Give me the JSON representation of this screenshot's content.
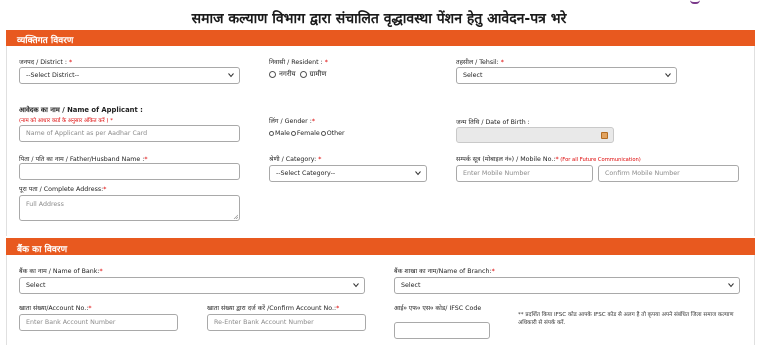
{
  "page": {
    "title": "समाज कल्याण विभाग द्वारा संचालित वृद्धावस्था पेंशन हेतु आवेदन-पत्र भरे"
  },
  "personal": {
    "heading": "व्यक्तिगत विवरण",
    "district": {
      "label": "जनपद / District :",
      "req": " *",
      "value": "--Select District--"
    },
    "resident": {
      "label": "निवासी / Resident :",
      "req": " *",
      "options": [
        "नगरीय",
        "ग्रामीण"
      ]
    },
    "tehsil": {
      "label": "तहसील / Tehsil:",
      "req": " *",
      "value": "Select"
    },
    "applicant": {
      "label": "आवेदक का नाम / Name of Applicant :",
      "hint": "(नाम को आधार कार्ड के अनुसार अंकित करें )",
      "req": " *",
      "placeholder": "Name of Applicant as per Aadhar Card"
    },
    "gender": {
      "label": "लिंग / Gender :",
      "req": "*",
      "options": [
        "Male",
        "Female",
        "Other"
      ]
    },
    "dob": {
      "label": "जन्म तिथि / Date of Birth :",
      "value": ""
    },
    "father": {
      "label": "पिता / पति का नाम / Father/Husband Name :",
      "req": "*",
      "value": ""
    },
    "category": {
      "label": "श्रेणी / Category:",
      "req": " *",
      "value": "--Select Category--"
    },
    "mobile": {
      "label": "सम्पर्क सूत्र (मोबाइल नं०) / Mobile No.:",
      "req": "*",
      "hint": " (For all Future Communication)",
      "placeholder": "Enter Mobile Number",
      "confirm_placeholder": "Confirm Mobile Number"
    },
    "address": {
      "label": "पूरा पता / Complete Address:",
      "req": "*",
      "placeholder": "Full Address"
    }
  },
  "bank": {
    "heading": "बैंक का विवरण",
    "bank_name": {
      "label": "बैंक का नाम / Name of Bank:",
      "req": "*",
      "value": "Select"
    },
    "branch": {
      "label": "बैंक शाखा का नाम/Name of Branch:",
      "req": "*",
      "value": "Select"
    },
    "account": {
      "label": "खाता संख्या/Account No.:",
      "req": "*",
      "placeholder": "Enter Bank Account Number"
    },
    "confirm_account": {
      "label": "खाता संख्या द्वारा दर्ज करें /Confirm Account No.:",
      "req": "*",
      "placeholder": "Re-Enter Bank Account Number"
    },
    "ifsc": {
      "label": "आई० एफ० एस० कोड/ IFSC Code",
      "value": ""
    },
    "ifsc_note": "** प्रदर्शित किया IFSC कोड आपके IFSC कोड से अलग है तो कृपया अपने संबंधित जिला समाज कल्याण अधिकारी से संपर्क करें."
  },
  "colors": {
    "header_bar": "#e8591f",
    "required": "#dd0000",
    "calendar": "#e2a35f"
  },
  "icons": [
    "chevron-down-icon",
    "calendar-icon",
    "resize-grip-icon"
  ]
}
